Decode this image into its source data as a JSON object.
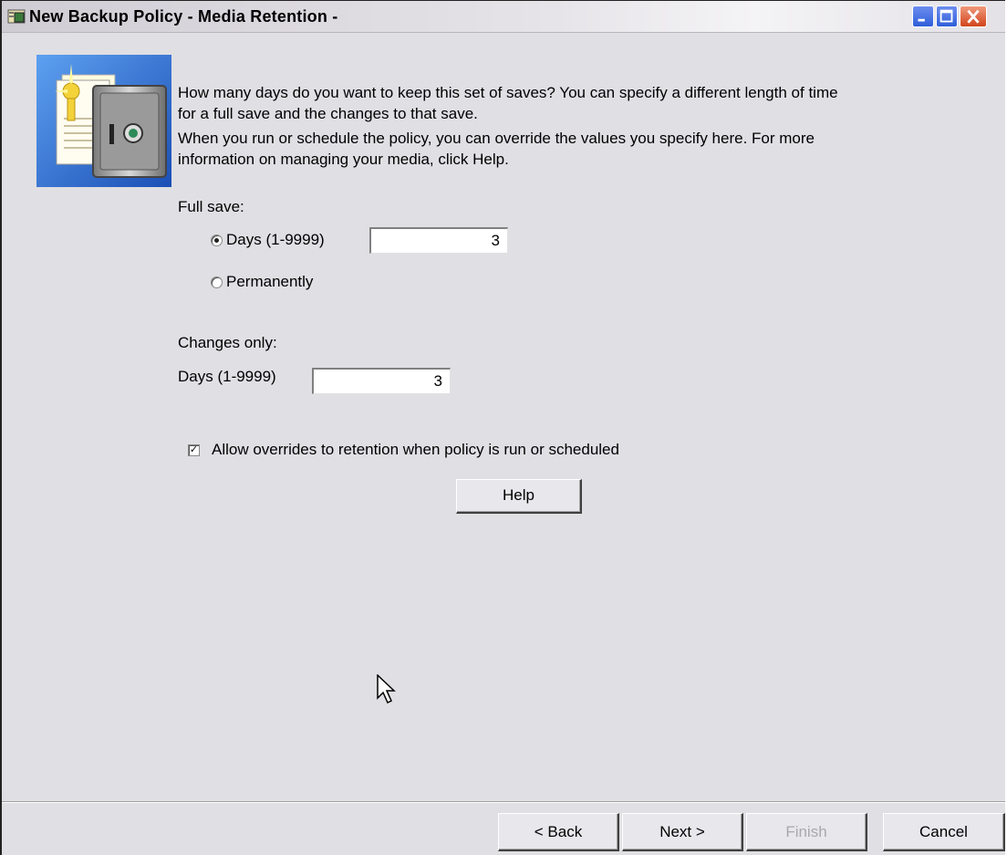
{
  "window": {
    "title": "New Backup Policy - Media Retention -",
    "controls": {
      "minimize": "minimize",
      "maximize": "maximize",
      "close": "close"
    }
  },
  "intro": {
    "paragraph1_line1": "How many days do you want to keep this set of saves? You can specify a different length of time",
    "paragraph1_line2": "for a full save and the changes to that save.",
    "paragraph2_line1": "When you run or schedule the policy, you can override the values you specify here. For more",
    "paragraph2_line2": "information on managing your media, click Help."
  },
  "full_save": {
    "heading": "Full save:",
    "days_label": "Days (1-9999)",
    "days_value": "3",
    "permanently_label": "Permanently",
    "selected": "days"
  },
  "changes_only": {
    "heading": "Changes only:",
    "days_label": "Days (1-9999)",
    "days_value": "3"
  },
  "allow_overrides": {
    "label": "Allow overrides to retention when policy is run or scheduled",
    "checked": true
  },
  "help_button": "Help",
  "footer": {
    "back": "< Back",
    "next": "Next >",
    "finish": "Finish",
    "cancel": "Cancel"
  },
  "icons": [
    "wizard-safe-icon",
    "title-app-icon",
    "minimize-icon",
    "maximize-icon",
    "close-icon",
    "mouse-cursor-icon"
  ]
}
